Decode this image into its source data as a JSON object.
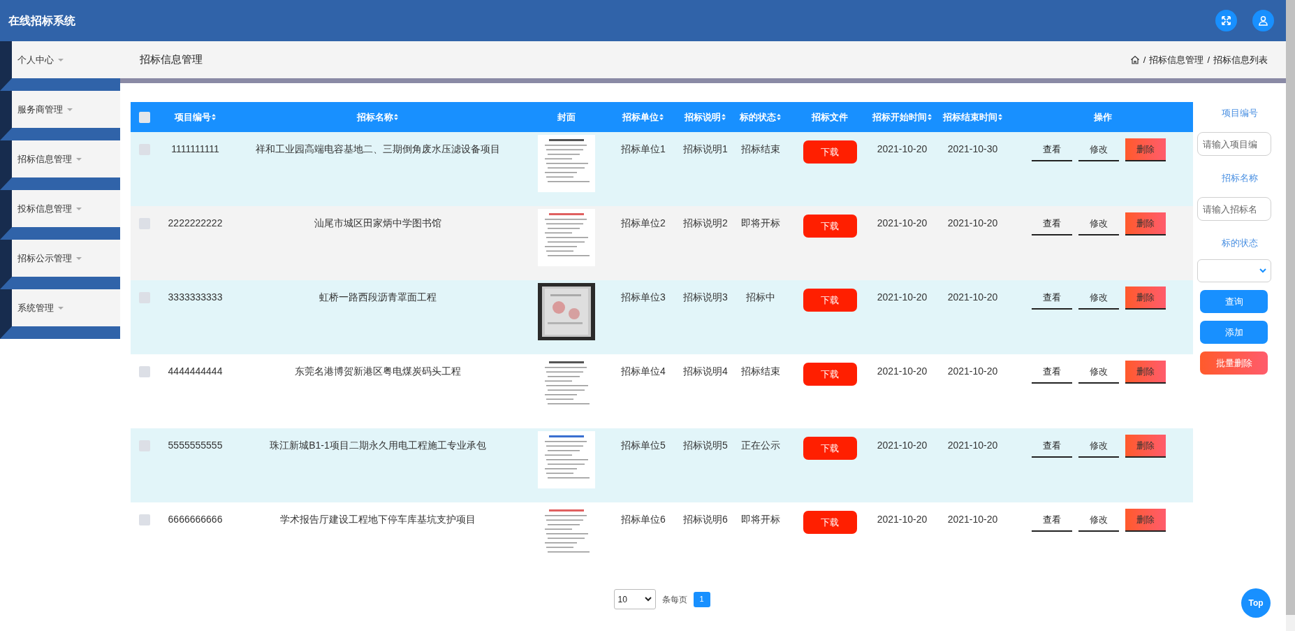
{
  "header": {
    "title": "在线招标系统"
  },
  "sidebar": {
    "items": [
      {
        "label": "个人中心"
      },
      {
        "label": "服务商管理"
      },
      {
        "label": "招标信息管理"
      },
      {
        "label": "投标信息管理"
      },
      {
        "label": "招标公示管理"
      },
      {
        "label": "系统管理"
      }
    ]
  },
  "page_header": {
    "title": "招标信息管理",
    "breadcrumb": {
      "separator": "/",
      "items": [
        "招标信息管理",
        "招标信息列表"
      ]
    }
  },
  "table": {
    "select_all": {
      "checked": false
    },
    "columns": [
      {
        "label": "项目编号",
        "sortable": true
      },
      {
        "label": "招标名称",
        "sortable": true
      },
      {
        "label": "封面",
        "sortable": false
      },
      {
        "label": "招标单位",
        "sortable": true
      },
      {
        "label": "招标说明",
        "sortable": true
      },
      {
        "label": "标的状态",
        "sortable": true
      },
      {
        "label": "招标文件",
        "sortable": false
      },
      {
        "label": "招标开始时间",
        "sortable": true
      },
      {
        "label": "招标结束时间",
        "sortable": true
      },
      {
        "label": "操作",
        "sortable": false
      }
    ],
    "rows": [
      {
        "checked": false,
        "hovered": false,
        "id": "1111111111",
        "name": "祥和工业园高端电容基地二、三期倒角废水压滤设备项目",
        "unit": "招标单位1",
        "description": "招标说明1",
        "status": "招标结束",
        "file_button": "下载",
        "start": "2021-10-20",
        "end": "2021-10-30",
        "actions": [
          {
            "label": "查看",
            "kind": "view"
          },
          {
            "label": "修改",
            "kind": "edit"
          },
          {
            "label": "删除",
            "kind": "delete"
          }
        ]
      },
      {
        "checked": false,
        "hovered": true,
        "id": "2222222222",
        "name": "汕尾市城区田家炳中学图书馆",
        "unit": "招标单位2",
        "description": "招标说明2",
        "status": "即将开标",
        "file_button": "下载",
        "start": "2021-10-20",
        "end": "2021-10-20",
        "actions": [
          {
            "label": "查看",
            "kind": "view"
          },
          {
            "label": "修改",
            "kind": "edit"
          },
          {
            "label": "删除",
            "kind": "delete"
          }
        ]
      },
      {
        "checked": false,
        "hovered": false,
        "id": "3333333333",
        "name": "虹桥一路西段沥青罩面工程",
        "unit": "招标单位3",
        "description": "招标说明3",
        "status": "招标中",
        "file_button": "下载",
        "start": "2021-10-20",
        "end": "2021-10-20",
        "actions": [
          {
            "label": "查看",
            "kind": "view"
          },
          {
            "label": "修改",
            "kind": "edit"
          },
          {
            "label": "删除",
            "kind": "delete"
          }
        ]
      },
      {
        "checked": false,
        "hovered": false,
        "id": "4444444444",
        "name": "东莞名港博贺新港区粤电煤炭码头工程",
        "unit": "招标单位4",
        "description": "招标说明4",
        "status": "招标结束",
        "file_button": "下载",
        "start": "2021-10-20",
        "end": "2021-10-20",
        "actions": [
          {
            "label": "查看",
            "kind": "view"
          },
          {
            "label": "修改",
            "kind": "edit"
          },
          {
            "label": "删除",
            "kind": "delete"
          }
        ]
      },
      {
        "checked": false,
        "hovered": false,
        "id": "5555555555",
        "name": "珠江新城B1-1项目二期永久用电工程施工专业承包",
        "unit": "招标单位5",
        "description": "招标说明5",
        "status": "正在公示",
        "file_button": "下载",
        "start": "2021-10-20",
        "end": "2021-10-20",
        "actions": [
          {
            "label": "查看",
            "kind": "view"
          },
          {
            "label": "修改",
            "kind": "edit"
          },
          {
            "label": "删除",
            "kind": "delete"
          }
        ]
      },
      {
        "checked": false,
        "hovered": false,
        "id": "6666666666",
        "name": "学术报告厅建设工程地下停车库基坑支护项目",
        "unit": "招标单位6",
        "description": "招标说明6",
        "status": "即将开标",
        "file_button": "下载",
        "start": "2021-10-20",
        "end": "2021-10-20",
        "actions": [
          {
            "label": "查看",
            "kind": "view"
          },
          {
            "label": "修改",
            "kind": "edit"
          },
          {
            "label": "删除",
            "kind": "delete"
          }
        ]
      }
    ]
  },
  "filters": {
    "fields": [
      {
        "label": "项目编号",
        "kind": "text",
        "placeholder": "请输入项目编"
      },
      {
        "label": "招标名称",
        "kind": "text",
        "placeholder": "请输入招标名"
      },
      {
        "label": "标的状态",
        "kind": "select"
      }
    ],
    "buttons": [
      {
        "label": "查询",
        "kind": "primary"
      },
      {
        "label": "添加",
        "kind": "primary"
      },
      {
        "label": "批量删除",
        "kind": "danger"
      }
    ]
  },
  "pagination": {
    "page_size": "10",
    "page_size_label": "条每页",
    "pages": [
      {
        "label": "1",
        "selected": true
      }
    ]
  },
  "back_to_top": {
    "label": "Top"
  }
}
